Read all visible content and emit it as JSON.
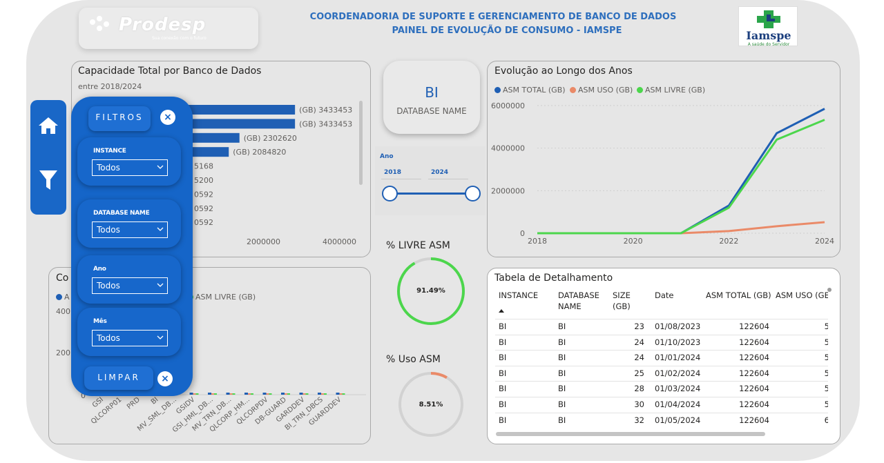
{
  "header": {
    "line1": "COORDENADORIA DE SUPORTE E GERENCIAMENTO DE BANCO DE DADOS",
    "line2": "PAINEL DE EVOLUÇÃO DE CONSUMO - IAMSPE"
  },
  "logo": {
    "name": "Prodesp",
    "tagline": "Sua conexão com o futuro"
  },
  "partner_logo": {
    "name": "Iamspe",
    "tagline": "A saúde do Servidor"
  },
  "nav": {
    "home": "home-icon",
    "filter": "filter-icon"
  },
  "filters": {
    "title": "FILTROS",
    "clear": "LIMPAR",
    "close": "×",
    "groups": [
      {
        "label": "INSTANCE",
        "value": "Todos"
      },
      {
        "label": "DATABASE NAME",
        "value": "Todos"
      },
      {
        "label": "Ano",
        "value": "Todos"
      },
      {
        "label": "Mês",
        "value": "Todos"
      }
    ]
  },
  "capacity_card": {
    "title": "Capacidade Total por Banco de Dados",
    "subtitle": "entre 2018/2024",
    "x_ticks": [
      "2000000",
      "4000000"
    ],
    "bar_labels": [
      "(GB) 3433453",
      "(GB) 3433453",
      "(GB) 2302620",
      "(GB) 2084820",
      "5168",
      "5200",
      "0592",
      "0592",
      "0592"
    ]
  },
  "database_card": {
    "value": "BI",
    "label": "DATABASE NAME"
  },
  "year_slicer": {
    "label": "Ano",
    "start": "2018",
    "end": "2024"
  },
  "livre_gauge": {
    "title": "% LIVRE ASM",
    "value": "91.49%",
    "fraction": 0.9149
  },
  "uso_gauge": {
    "title": "% Uso ASM",
    "value": "8.51%",
    "fraction": 0.0851
  },
  "evolution_card": {
    "title": "Evolução ao Longo dos Anos",
    "legend": [
      "ASM TOTAL (GB)",
      "ASM USO (GB)",
      "ASM LIVRE  (GB)"
    ],
    "y_ticks": [
      "6000000",
      "4000000",
      "2000000",
      "0"
    ],
    "x_ticks": [
      "2018",
      "2020",
      "2022",
      "2024"
    ]
  },
  "comparison_card": {
    "title_fragment": "Co",
    "legend_fragment_a": "A",
    "legend_fragment_b": "ASM LIVRE  (GB)",
    "y_ticks": [
      "400",
      "200",
      "0"
    ],
    "categories": [
      "GSI",
      "QLCORP01",
      "PRD",
      "BI",
      "MV_SML_DB...",
      "GSIDV",
      "GSI_HML_DB...",
      "MV_TRN_DB...",
      "QLCORP_HM...",
      "QLCORPDV",
      "DB-GUARD",
      "GARDDEV",
      "BI_TRN_DBCS",
      "GUARDDEV"
    ]
  },
  "detail_table": {
    "title": "Tabela de Detalhamento",
    "columns": [
      "INSTANCE",
      "DATABASE NAME",
      "SIZE (GB)",
      "Date",
      "ASM TOTAL (GB)",
      "ASM USO (GE"
    ],
    "rows": [
      [
        "BI",
        "BI",
        "23",
        "01/08/2023",
        "122604",
        "5"
      ],
      [
        "BI",
        "BI",
        "24",
        "01/10/2023",
        "122604",
        "5"
      ],
      [
        "BI",
        "BI",
        "24",
        "01/01/2024",
        "122604",
        "5"
      ],
      [
        "BI",
        "BI",
        "25",
        "01/02/2024",
        "122604",
        "5"
      ],
      [
        "BI",
        "BI",
        "28",
        "01/03/2024",
        "122604",
        "5"
      ],
      [
        "BI",
        "BI",
        "30",
        "01/04/2024",
        "122604",
        "5"
      ],
      [
        "BI",
        "BI",
        "32",
        "01/05/2024",
        "122604",
        "6"
      ]
    ]
  },
  "colors": {
    "asm_total": "#1f5fb4",
    "asm_uso": "#ea8a68",
    "asm_livre": "#4cd64c",
    "accent": "#1565c8",
    "header": "#2e6fbd"
  },
  "chart_data": [
    {
      "type": "bar",
      "title": "Capacidade Total por Banco de Dados",
      "subtitle": "entre 2018/2024",
      "orientation": "horizontal",
      "values": [
        3433453,
        3433453,
        2302620,
        2084820
      ],
      "xlim": [
        0,
        4500000
      ]
    },
    {
      "type": "line",
      "title": "Evolução ao Longo dos Anos",
      "x": [
        2018,
        2019,
        2020,
        2021,
        2022,
        2023,
        2024
      ],
      "series": [
        {
          "name": "ASM TOTAL (GB)",
          "values": [
            0,
            0,
            0,
            0,
            1300000,
            4700000,
            5850000
          ]
        },
        {
          "name": "ASM USO (GB)",
          "values": [
            0,
            0,
            0,
            0,
            100000,
            330000,
            520000
          ]
        },
        {
          "name": "ASM LIVRE  (GB)",
          "values": [
            0,
            0,
            0,
            0,
            1200000,
            4400000,
            5330000
          ]
        }
      ],
      "ylim": [
        0,
        6000000
      ],
      "legend": "top-left"
    }
  ]
}
